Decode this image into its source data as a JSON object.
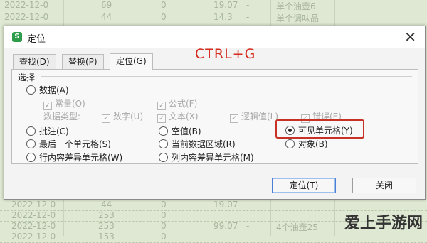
{
  "sheet": {
    "top_rows": [
      [
        "2022-12-0",
        "69",
        "0",
        "19.07",
        "-",
        "单个油壶6"
      ],
      [
        "2022-12-0",
        "44",
        "0",
        "14.3",
        "-",
        "单个调味品"
      ]
    ],
    "bottom_rows": [
      [
        "2022-12-0",
        "44",
        "0",
        "19.07",
        "-",
        ""
      ],
      [
        "2022-12-0",
        "253",
        "0",
        "",
        "",
        ""
      ],
      [
        "2022-12-0",
        "253",
        "0",
        "99.07",
        "-",
        "4个油壶25"
      ],
      [
        "2022-12-0",
        "153",
        "0",
        "",
        "",
        ""
      ]
    ]
  },
  "dialog": {
    "title": "定位",
    "tabs": [
      "查找(D)",
      "替换(P)",
      "定位(G)"
    ],
    "annotation": "CTRL+G",
    "group_label": "选择",
    "options": {
      "data": "数据(A)",
      "constant": "常量(O)",
      "formula": "公式(F)",
      "data_type_label": "数据类型:",
      "number": "数字(U)",
      "text": "文本(X)",
      "logic": "逻辑值(L)",
      "error": "错误(E)",
      "comment": "批注(C)",
      "blank": "空值(B)",
      "visible": "可见单元格(Y)",
      "last_cell": "最后一个单元格(S)",
      "current_region": "当前数据区域(R)",
      "object": "对象(B)",
      "row_diff": "行内容差异单元格(W)",
      "col_diff": "列内容差异单元格(M)"
    },
    "selected_option": "visible",
    "buttons": {
      "ok": "定位(T)",
      "close": "关闭"
    }
  },
  "watermark": "爱上手游网",
  "colors": {
    "highlight": "#c83226",
    "annotation": "#d62b1f",
    "sheet_bg": "#dfe8d2"
  }
}
